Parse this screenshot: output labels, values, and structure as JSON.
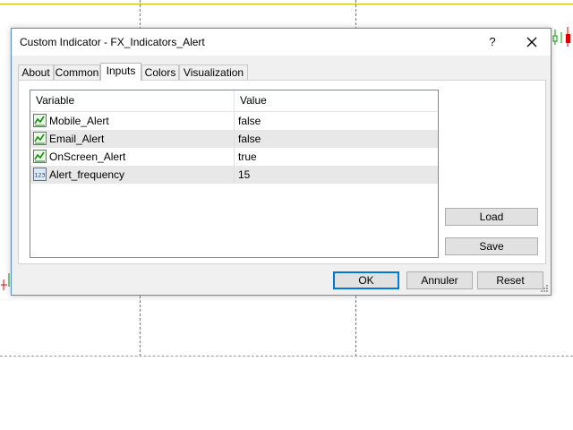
{
  "window": {
    "title": "Custom Indicator - FX_Indicators_Alert"
  },
  "titlebar": {
    "help_glyph": "?",
    "close_icon": "close-icon"
  },
  "tabs": [
    {
      "label": "About"
    },
    {
      "label": "Common"
    },
    {
      "label": "Inputs",
      "active": true
    },
    {
      "label": "Colors"
    },
    {
      "label": "Visualization"
    }
  ],
  "inputs_table": {
    "columns": [
      "Variable",
      "Value"
    ],
    "rows": [
      {
        "icon": "boolean-chart-icon",
        "name": "Mobile_Alert",
        "value": "false"
      },
      {
        "icon": "boolean-chart-icon",
        "name": "Email_Alert",
        "value": "false"
      },
      {
        "icon": "boolean-chart-icon",
        "name": "OnScreen_Alert",
        "value": "true"
      },
      {
        "icon": "integer-123-icon",
        "name": "Alert_frequency",
        "value": "15"
      }
    ]
  },
  "side_buttons": {
    "load": "Load",
    "save": "Save"
  },
  "footer_buttons": {
    "ok": "OK",
    "cancel": "Annuler",
    "reset": "Reset"
  },
  "colors": {
    "accent": "#0078d7",
    "chart_gold": "#d9b600",
    "bull": "#00a000",
    "bear": "#e00000"
  }
}
